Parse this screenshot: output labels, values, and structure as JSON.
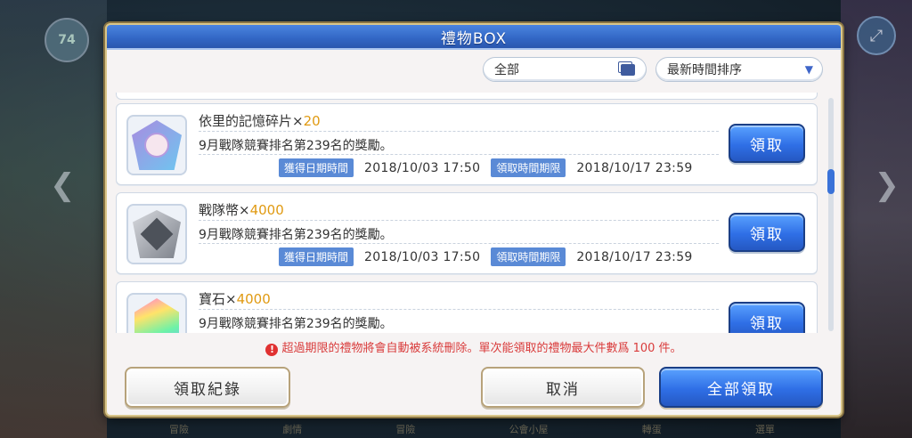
{
  "background": {
    "level_badge": "74",
    "left_arrow": "❮",
    "right_arrow": "❯",
    "expand_glyph": "⤢",
    "nav_items": [
      "冒險",
      "劇情",
      "冒險",
      "公會小屋",
      "轉蛋",
      "選單"
    ]
  },
  "dialog": {
    "title": "禮物BOX",
    "filter": {
      "category": "全部",
      "sort": "最新時間排序"
    },
    "gifts": [
      {
        "name": "依里的記憶碎片",
        "times": "×",
        "qty": "20",
        "description": "9月戰隊競賽排名第239名的獎勵。",
        "acquired_label": "獲得日期時間",
        "acquired_date": "2018/10/03 17:50",
        "deadline_label": "領取時間期限",
        "deadline_date": "2018/10/17 23:59",
        "claim_label": "領取",
        "icon": "memory-shard-icon"
      },
      {
        "name": "戰隊幣",
        "times": "×",
        "qty": "4000",
        "description": "9月戰隊競賽排名第239名的獎勵。",
        "acquired_label": "獲得日期時間",
        "acquired_date": "2018/10/03 17:50",
        "deadline_label": "領取時間期限",
        "deadline_date": "2018/10/17 23:59",
        "claim_label": "領取",
        "icon": "clan-coin-icon"
      },
      {
        "name": "寶石",
        "times": "×",
        "qty": "4000",
        "description": "9月戰隊競賽排名第239名的獎勵。",
        "claim_label": "領取",
        "icon": "gem-icon"
      }
    ],
    "warning": "超過期限的禮物將會自動被系統刪除。單次能領取的禮物最大件數爲 100 件。",
    "warning_icon": "!",
    "buttons": {
      "history": "領取紀錄",
      "cancel": "取消",
      "claim_all": "全部領取"
    }
  },
  "colors": {
    "accent_blue": "#2f6fe6",
    "qty_orange": "#e09a12",
    "warning_red": "#d93b3b",
    "tag_blue": "#5a8ad6"
  }
}
